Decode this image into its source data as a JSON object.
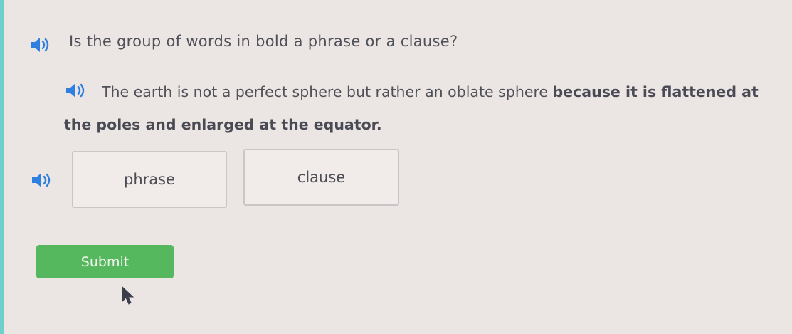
{
  "question": {
    "prompt": "Is the group of words in bold a phrase or a clause?",
    "audio_icon": "speaker-icon"
  },
  "sentence": {
    "plain": "The earth is not a perfect sphere but rather an oblate sphere ",
    "bold": "because it is flattened at the poles and enlarged at the equator.",
    "audio_icon": "speaker-icon"
  },
  "choices": {
    "audio_icon": "speaker-icon",
    "items": [
      {
        "label": "phrase"
      },
      {
        "label": "clause"
      }
    ]
  },
  "submit": {
    "label": "Submit",
    "color": "#55b85e"
  },
  "colors": {
    "speaker": "#2f7fe0",
    "accent_edge": "#6fcfc9"
  }
}
